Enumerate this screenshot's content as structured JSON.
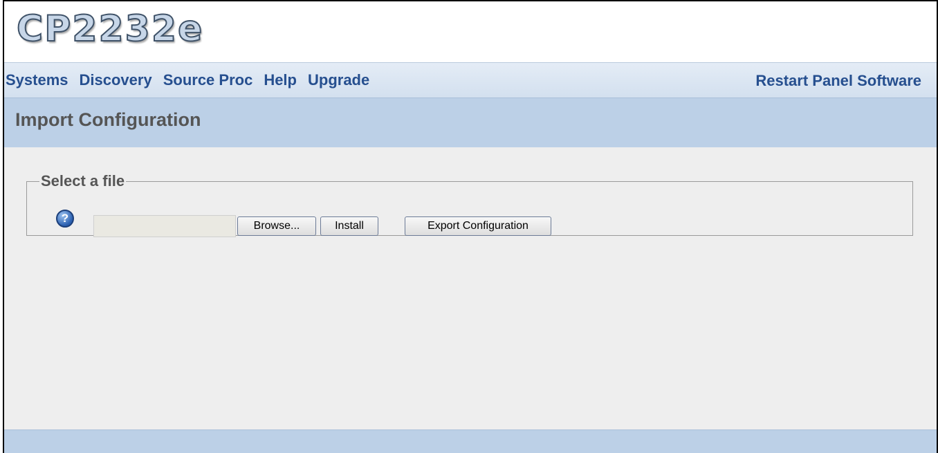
{
  "app": {
    "logo_text": "CP2232e"
  },
  "nav": {
    "items": [
      {
        "label": "Systems"
      },
      {
        "label": "Discovery"
      },
      {
        "label": "Source Proc"
      },
      {
        "label": "Help"
      },
      {
        "label": "Upgrade"
      }
    ],
    "right_link": "Restart Panel Software"
  },
  "page": {
    "title": "Import Configuration"
  },
  "file_section": {
    "legend": "Select a file",
    "help_icon": "question-circle-icon",
    "help_glyph": "?",
    "file_path_value": "",
    "browse_label": "Browse...",
    "install_label": "Install",
    "export_label": "Export Configuration"
  },
  "colors": {
    "nav_text": "#264f8f",
    "title_bar": "#bcd0e7",
    "content_bg": "#eeeeee"
  }
}
